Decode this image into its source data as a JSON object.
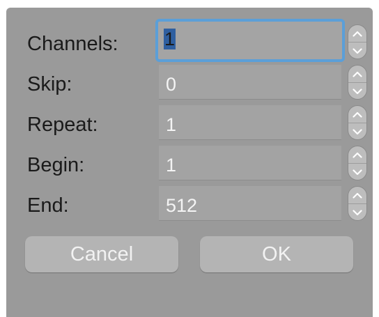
{
  "fields": [
    {
      "label": "Channels:",
      "value": "1",
      "focused": true
    },
    {
      "label": "Skip:",
      "value": "0"
    },
    {
      "label": "Repeat:",
      "value": "1"
    },
    {
      "label": "Begin:",
      "value": "1"
    },
    {
      "label": "End:",
      "value": "512"
    }
  ],
  "buttons": {
    "cancel_label": "Cancel",
    "ok_label": "OK"
  },
  "colors": {
    "dialog_background": "#9a9a9a",
    "focus_ring": "#5b9fd8",
    "text_selection": "#2f5fa0"
  }
}
